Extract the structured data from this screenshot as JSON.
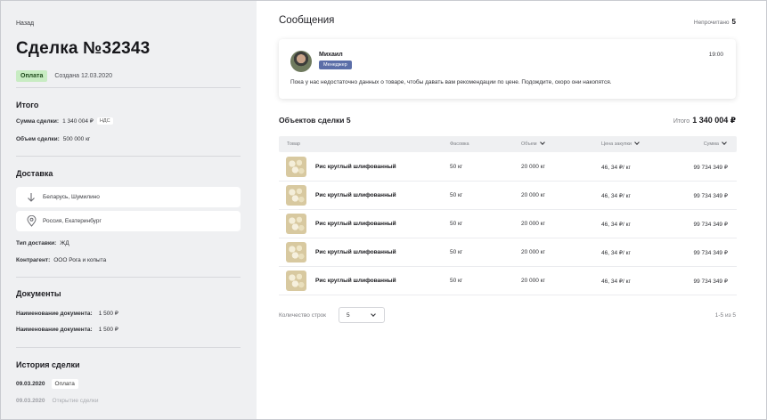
{
  "sidebar": {
    "back_label": "Назад",
    "deal_title": "Сделка №32343",
    "status_badge": "Оплата",
    "created": "Создана 12.03.2020",
    "totals": {
      "title": "Итого",
      "sum_label": "Сумма сделки:",
      "sum_value": "1 340 004 ₽",
      "vat_badge": "НДС",
      "volume_label": "Объем сделки:",
      "volume_value": "500 000 кг"
    },
    "delivery": {
      "title": "Доставка",
      "from": "Беларусь, Шумилино",
      "to": "Россия, Екатеринбург",
      "type_label": "Тип доставки:",
      "type_value": "ЖД",
      "contractor_label": "Контрагент:",
      "contractor_value": "ООО Рога и копыта"
    },
    "documents": {
      "title": "Документы",
      "items": [
        {
          "label": "Наименование документа:",
          "value": "1 500 ₽"
        },
        {
          "label": "Наименование документа:",
          "value": "1 500 ₽"
        }
      ]
    },
    "history": {
      "title": "История сделки",
      "items": [
        {
          "date": "09.03.2020",
          "event": "Оплата"
        },
        {
          "date": "09.03.2020",
          "event": "Открытие сделки"
        }
      ]
    }
  },
  "messages": {
    "title": "Сообщения",
    "unread_label": "Непрочитано",
    "unread_count": "5",
    "card": {
      "name": "Михаил",
      "role": "Менеджер",
      "time": "19:00",
      "text": "Пока у нас недостаточно данных о товаре, чтобы давать вам рекомендации по цене. Подождите, скоро они накопятся."
    }
  },
  "objects": {
    "title": "Объектов сделки 5",
    "total_label": "Итого",
    "total_value": "1 340 004 ₽",
    "columns": [
      "Товар",
      "Фасовка",
      "Объем",
      "Цена закупки",
      "Сумма"
    ],
    "rows": [
      {
        "name": "Рис круглый шлифованный",
        "pack": "50 кг",
        "volume": "20 000 кг",
        "price": "46, 34 ₽/ кг",
        "sum": "99 734 349 ₽"
      },
      {
        "name": "Рис круглый шлифованный",
        "pack": "50 кг",
        "volume": "20 000 кг",
        "price": "46, 34 ₽/ кг",
        "sum": "99 734 349 ₽"
      },
      {
        "name": "Рис круглый шлифованный",
        "pack": "50 кг",
        "volume": "20 000 кг",
        "price": "46, 34 ₽/ кг",
        "sum": "99 734 349 ₽"
      },
      {
        "name": "Рис круглый шлифованный",
        "pack": "50 кг",
        "volume": "20 000 кг",
        "price": "46, 34 ₽/ кг",
        "sum": "99 734 349 ₽"
      },
      {
        "name": "Рис круглый шлифованный",
        "pack": "50 кг",
        "volume": "20 000 кг",
        "price": "46, 34 ₽/ кг",
        "sum": "99 734 349 ₽"
      }
    ],
    "pager": {
      "rows_label": "Количество строк",
      "rows_value": "5",
      "range": "1-5 из 5"
    }
  },
  "colors": {
    "sidebar_bg": "#eff0f2",
    "status_green": "#c8ecc3",
    "role_badge": "#5b6ea8"
  }
}
